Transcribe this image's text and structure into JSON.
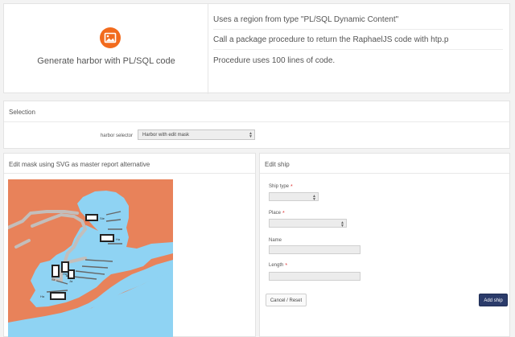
{
  "top": {
    "hero_text": "Generate harbor with PL/SQL code",
    "hero_icon": "image-icon",
    "accent_color": "#f26b1d",
    "lines": [
      "Uses a region from type \"PL/SQL Dynamic Content\"",
      "Call a package procedure to return the RaphaelJS code with htp.p",
      "Procedure uses 100 lines of code."
    ]
  },
  "selection": {
    "title": "Selection",
    "label": "harbor selector",
    "value": "Harbor with edit mask"
  },
  "map_panel": {
    "title": "Edit mask using SVG as master report alternative",
    "land_color": "#e8825a",
    "water_color": "#8fd3f3",
    "road_color": "#c3bebb",
    "labels": [
      "Ste",
      "Ha",
      "Sk",
      "Ha",
      "Ja",
      "Ha"
    ]
  },
  "edit_panel": {
    "title": "Edit ship",
    "fields": {
      "ship_type": "Ship type",
      "place": "Place",
      "name": "Name",
      "length": "Length"
    },
    "required_mark": "*",
    "cancel_label": "Cancel / Reset",
    "add_label": "Add ship"
  }
}
